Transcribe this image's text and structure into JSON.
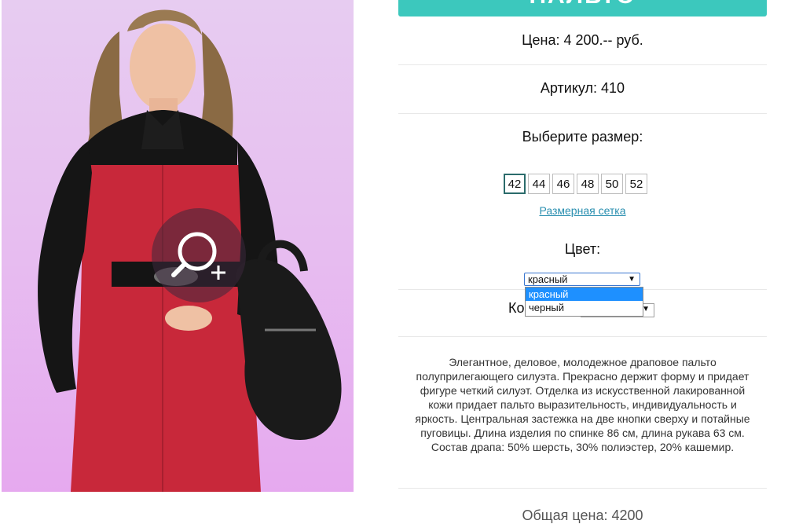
{
  "product": {
    "title": "ПАЛЬТО",
    "price": "Цена: 4 200.-- руб.",
    "article": "Артикул: 410",
    "size_heading": "Выберите размер:",
    "sizes": [
      "42",
      "44",
      "46",
      "48",
      "50",
      "52"
    ],
    "selected_size": "42",
    "size_chart_link": "Размерная сетка",
    "color_heading": "Цвет:",
    "color_select": {
      "selected": "красный",
      "options": [
        "красный",
        "черный"
      ]
    },
    "quantity_label": "Ко",
    "description": "Элегантное, деловое, молодежное драповое пальто полуприлегающего силуэта. Прекрасно держит форму и придает фигуре четкий силуэт. Отделка из искусственной лакированной кожи придает пальто выразительность, индивидуальность и яркость. Центральная застежка на две кнопки сверху и потайные пуговицы. Длина изделия по спинке 86 см, длина рукава 63 см. Состав драпа: 50% шерсть, 30% полиэстер, 20% кашемир.",
    "total": "Общая цена: 4200"
  },
  "colors": {
    "accent": "#3cc8bd",
    "link": "#2a8fb0",
    "dropdown_highlight": "#1e90ff",
    "coat_red": "#c8283a",
    "leather_black": "#151515"
  },
  "icons": {
    "zoom": "magnifier-plus-icon",
    "select_arrow": "triangle-down-icon"
  }
}
